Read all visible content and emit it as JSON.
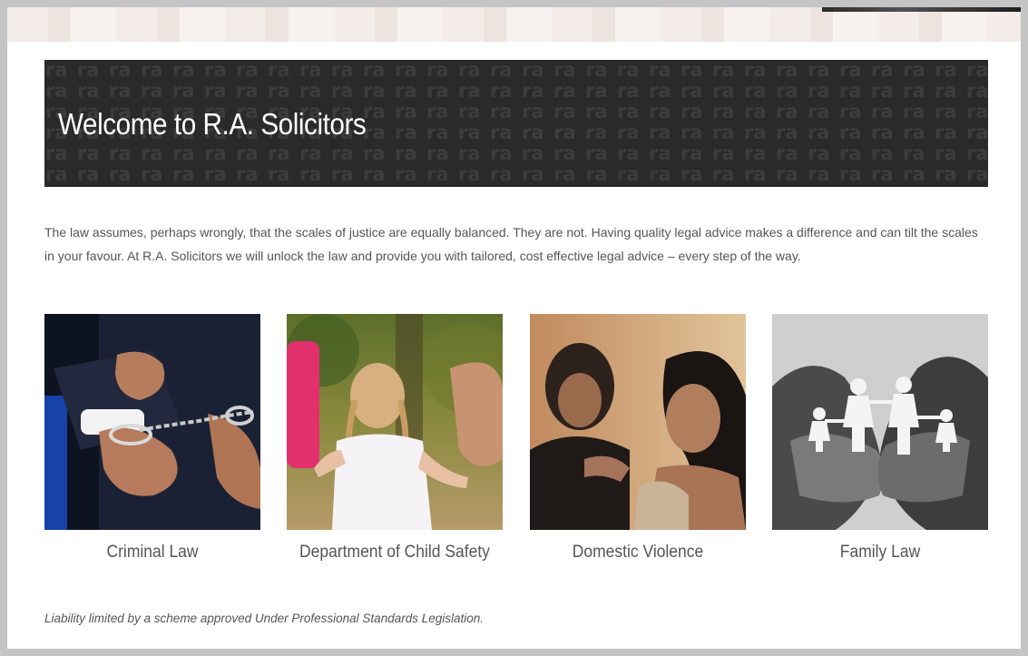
{
  "hero": {
    "title": "Welcome to R.A. Solicitors",
    "pattern_text": "ra"
  },
  "intro": {
    "text": "The law assumes, perhaps wrongly, that the scales of justice are equally balanced. They are not. Having quality legal advice makes a difference and can tilt the scales in your favour. At R.A. Solicitors we will unlock the law and provide you with tailored, cost effective legal advice – every step of the way."
  },
  "services": [
    {
      "label": "Criminal Law",
      "image": "handcuffed-hands-photo"
    },
    {
      "label": "Department of Child Safety",
      "image": "child-holding-hands-photo"
    },
    {
      "label": "Domestic Violence",
      "image": "distressed-woman-photo"
    },
    {
      "label": "Family Law",
      "image": "paper-family-in-hands-photo"
    }
  ],
  "footer": {
    "liability_note": "Liability limited by a scheme approved Under Professional Standards Legislation."
  },
  "colors": {
    "page_background": "#c4c4c4",
    "content_background": "#ffffff",
    "hero_background": "#2b2a2a",
    "body_text": "#555555"
  }
}
